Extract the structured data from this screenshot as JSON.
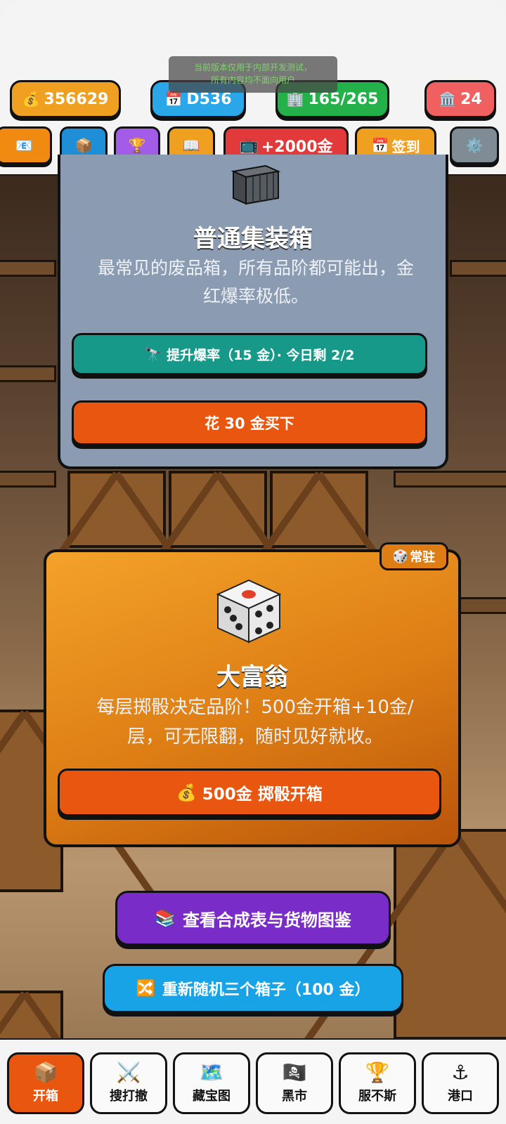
{
  "dev_notice": {
    "line1": "当前版本仅用于内部开发测试，",
    "line2": "所有内容均不面向用户"
  },
  "stats": {
    "gold": "356629",
    "day": "D536",
    "capacity": "165/265",
    "bank": "24"
  },
  "toolbar": {
    "ad_label": "+2000金",
    "sign_label": "签到"
  },
  "card_common": {
    "title": "普通集装箱",
    "desc_line1": "最常见的废品箱，所有品阶都可能出，金",
    "desc_line2": "红爆率极低。",
    "boost_label": "提升爆率（15 金）· 今日剩 2/2",
    "buy_label": "花 30 金买下"
  },
  "card_monopoly": {
    "badge": "常驻",
    "title": "大富翁",
    "desc_line1": "每层掷骰决定品阶！500金开箱+10金/",
    "desc_line2": "层，可无限翻，随时见好就收。",
    "open_label": "500金 掷骰开箱"
  },
  "actions": {
    "catalog_label": "查看合成表与货物图鉴",
    "reroll_label": "重新随机三个箱子（100 金）"
  },
  "nav": [
    {
      "label": "开箱",
      "icon": "📦",
      "active": true
    },
    {
      "label": "搜打撤",
      "icon": "⚔️"
    },
    {
      "label": "藏宝图",
      "icon": "🗺️"
    },
    {
      "label": "黑市",
      "icon": "🏴‍☠️"
    },
    {
      "label": "服不斯",
      "icon": "🏆"
    },
    {
      "label": "港口",
      "icon": "⚓"
    }
  ],
  "colors": {
    "accent_orange": "#e8560f",
    "teal": "#17998a",
    "purple": "#7a2cc9",
    "blue": "#17a3e6"
  }
}
